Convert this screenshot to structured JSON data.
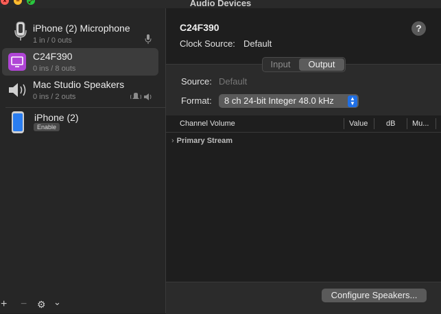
{
  "window": {
    "title": "Audio Devices"
  },
  "sidebar": {
    "devices": [
      {
        "name": "iPhone (2) Microphone",
        "sub": "1 in / 0 outs",
        "icon": "iphone-microphone-icon"
      },
      {
        "name": "C24F390",
        "sub": "0 ins / 8 outs",
        "icon": "display-icon",
        "selected": true
      },
      {
        "name": "Mac Studio Speakers",
        "sub": "0 ins / 2 outs",
        "icon": "speaker-icon"
      },
      {
        "name": "iPhone (2)",
        "sub": "",
        "badge": "Enable",
        "icon": "iphone-icon"
      }
    ],
    "footer": {
      "add": "+",
      "remove": "−",
      "gear": "⚙",
      "chevron": "⌄"
    }
  },
  "detail": {
    "device_title": "C24F390",
    "clock_label": "Clock Source:",
    "clock_value": "Default",
    "help": "?",
    "tabs": [
      {
        "label": "Input"
      },
      {
        "label": "Output",
        "active": true
      }
    ],
    "source_label": "Source:",
    "source_value": "Default",
    "format_label": "Format:",
    "format_value": "8 ch 24-bit Integer 48.0 kHz",
    "columns": [
      "Channel Volume",
      "Value",
      "dB",
      "Mu..."
    ],
    "stream_label": "Primary Stream",
    "configure_button": "Configure Speakers..."
  },
  "colors": {
    "accent": "#1f6fe5",
    "selected_icon_bg": "#b045d6"
  }
}
